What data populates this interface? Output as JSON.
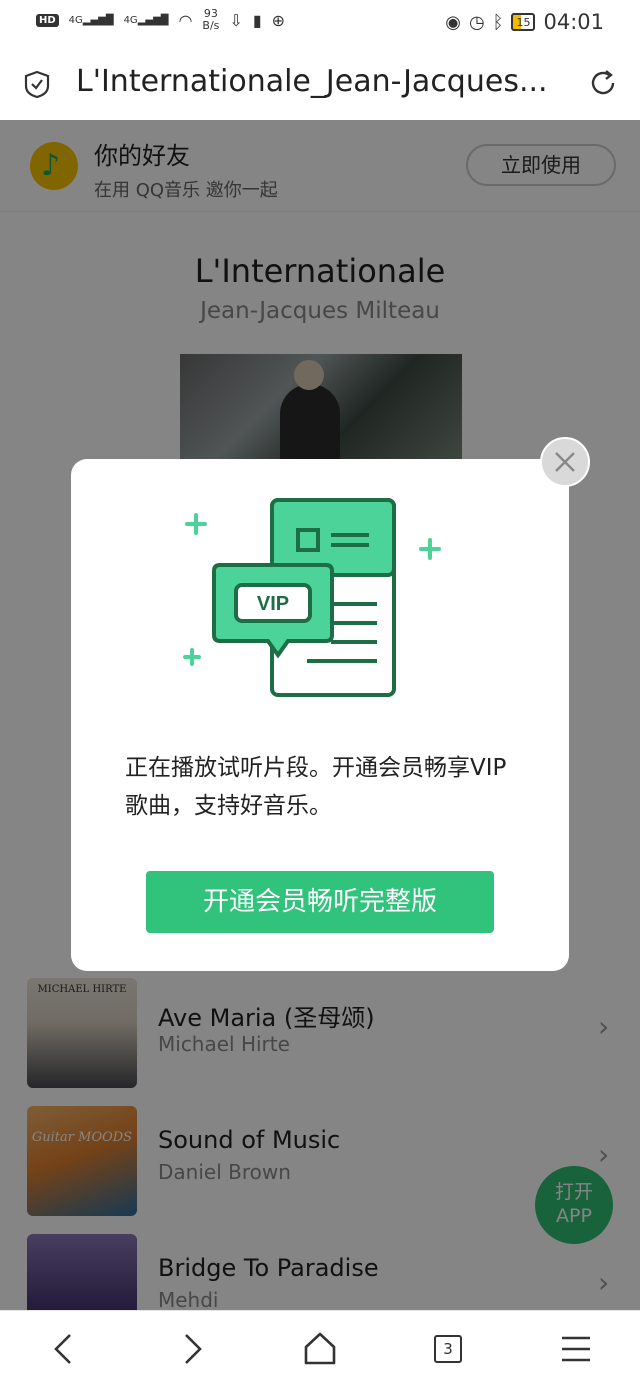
{
  "status_bar": {
    "hd": "HD",
    "sig1": "4G",
    "sig2": "4G",
    "speed_top": "93",
    "speed_bottom": "B/s",
    "battery": "15",
    "time": "04:01"
  },
  "browser": {
    "page_title": "L'Internationale_Jean-Jacques...",
    "tab_count": "3"
  },
  "friend_bar": {
    "title": "你的好友",
    "subtitle": "在用 QQ音乐 邀你一起",
    "button_label": "立即使用"
  },
  "song": {
    "title": "L'Internationale",
    "artist": "Jean-Jacques Milteau"
  },
  "modal": {
    "vip_badge": "VIP",
    "message": "正在播放试听片段。开通会员畅享VIP歌曲，支持好音乐。",
    "cta_label": "开通会员畅听完整版"
  },
  "recommendations": [
    {
      "name": "Ave Maria (圣母颂)",
      "artist": "Michael Hirte",
      "cover_text": "MICHAEL HIRTE"
    },
    {
      "name": "Sound of Music",
      "artist": "Daniel Brown",
      "cover_text": "Guitar MOODS"
    },
    {
      "name": "Bridge To Paradise",
      "artist": "Mehdi",
      "cover_text": ""
    }
  ],
  "open_app": {
    "line1": "打开",
    "line2": "APP"
  },
  "colors": {
    "accent_green": "#31c27c",
    "qq_yellow": "#f8c300"
  }
}
